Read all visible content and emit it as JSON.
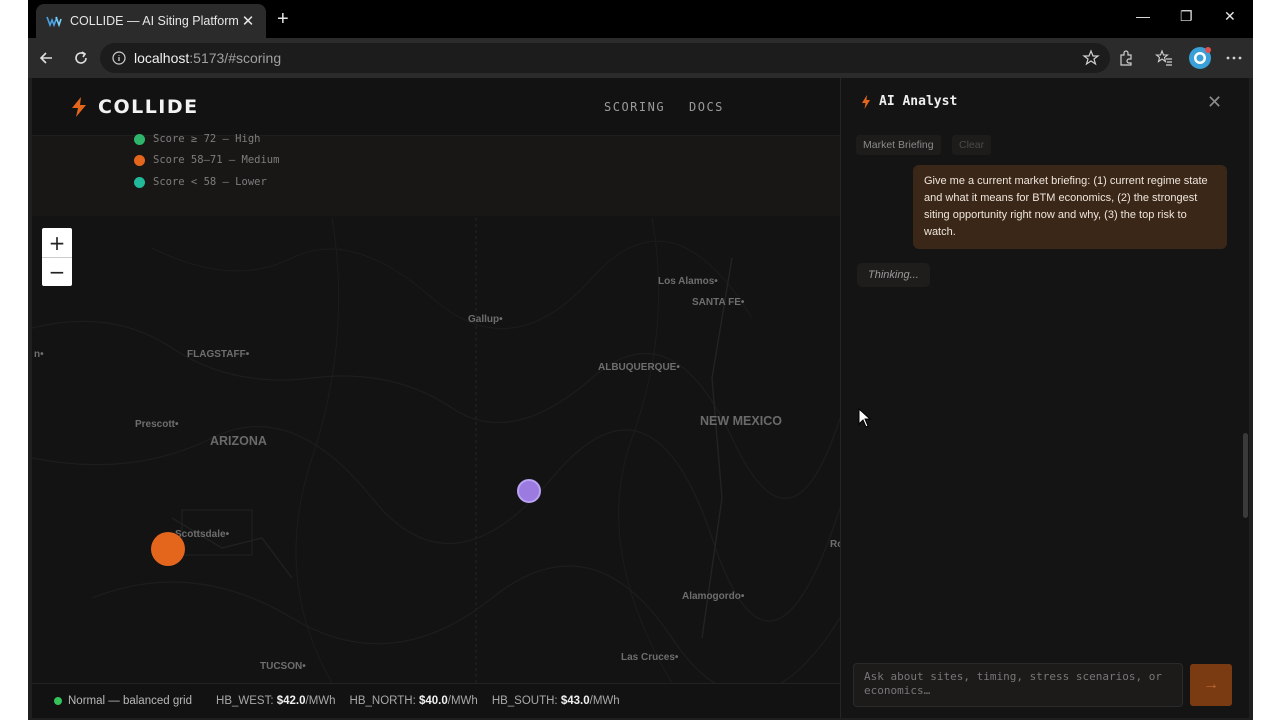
{
  "browser": {
    "tab_title": "COLLIDE — AI Siting Platform for B",
    "url_host": "localhost",
    "url_rest": ":5173/#scoring"
  },
  "navbar": {
    "logo": "COLLIDE",
    "links": [
      "SCORING",
      "DOCS"
    ]
  },
  "legend": [
    {
      "label": "Score ≥ 72 — High",
      "color": "#2fb56b"
    },
    {
      "label": "Score 58–71 — Medium",
      "color": "#e4661c"
    },
    {
      "label": "Score < 58 — Lower",
      "color": "#22b89a"
    }
  ],
  "map": {
    "zoom_in": "+",
    "zoom_out": "−",
    "labels": {
      "los_alamos": "Los Alamos•",
      "santa_fe": "SANTA FE•",
      "gallup": "Gallup•",
      "flagstaff": "FLAGSTAFF•",
      "albuquerque": "ALBUQUERQUE•",
      "prescott": "Prescott•",
      "arizona": "ARIZONA",
      "new_mexico": "NEW MEXICO",
      "scottsdale": "Scottsdale•",
      "alamogordo": "Alamogordo•",
      "tucson": "TUCSON•",
      "las_cruces": "Las Cruces•",
      "ro": "Ro"
    },
    "marker_colors": {
      "orange": "#e4661c",
      "purple": "#9b7be0"
    }
  },
  "status": {
    "grid_state": "Normal — balanced grid",
    "hubs": [
      {
        "name": "HB_WEST:",
        "price": "$42.0",
        "unit": "/MWh"
      },
      {
        "name": "HB_NORTH:",
        "price": "$40.0",
        "unit": "/MWh"
      },
      {
        "name": "HB_SOUTH:",
        "price": "$43.0",
        "unit": "/MWh"
      }
    ]
  },
  "panel": {
    "title": "AI Analyst",
    "chips": [
      "Market Briefing",
      "Clear"
    ],
    "user_message": "Give me a current market briefing: (1) current regime state and what it means for BTM economics, (2) the strongest siting opportunity right now and why, (3) the top risk to watch.",
    "thinking": "Thinking...",
    "input_placeholder": "Ask about sites, timing, stress scenarios, or economics…",
    "send": "→"
  },
  "colors": {
    "accent": "#e4661c",
    "status_ok": "#35c25a"
  }
}
